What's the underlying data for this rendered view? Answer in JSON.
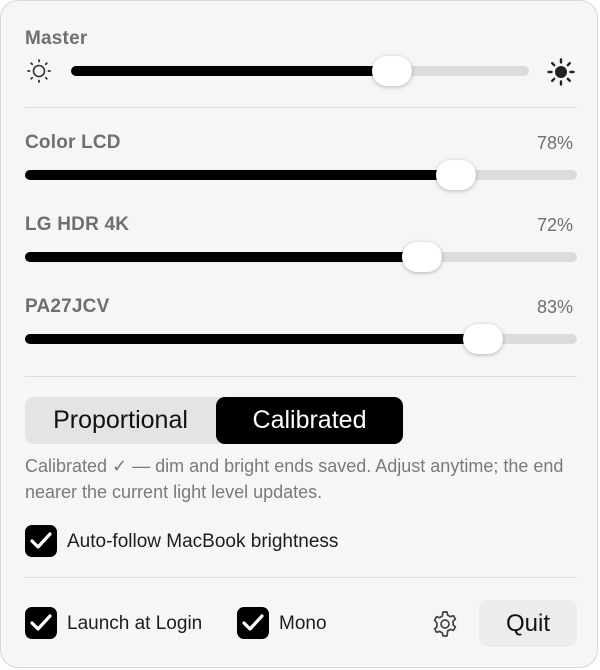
{
  "master": {
    "label": "Master",
    "value": 0.7,
    "min_icon": "sun-dim-icon",
    "max_icon": "sun-bright-icon"
  },
  "displays": [
    {
      "name": "Color LCD",
      "percent_label": "78%",
      "value": 0.78
    },
    {
      "name": "LG HDR 4K",
      "percent_label": "72%",
      "value": 0.72
    },
    {
      "name": "PA27JCV",
      "percent_label": "83%",
      "value": 0.83
    }
  ],
  "mode": {
    "options": [
      "Proportional",
      "Calibrated"
    ],
    "selected": "Calibrated",
    "description": "Calibrated ✓ — dim and bright ends saved. Adjust anytime; the end nearer the current light level updates."
  },
  "auto_follow": {
    "label": "Auto-follow MacBook brightness",
    "checked": true
  },
  "footer": {
    "launch_at_login": {
      "label": "Launch at Login",
      "checked": true
    },
    "mono": {
      "label": "Mono",
      "checked": true
    },
    "settings_icon": "gear-icon",
    "quit_label": "Quit"
  },
  "colors": {
    "fill": "#000000",
    "track": "#dcdcdc",
    "background": "#f6f6f6",
    "secondary_text": "#6f6f6f"
  }
}
